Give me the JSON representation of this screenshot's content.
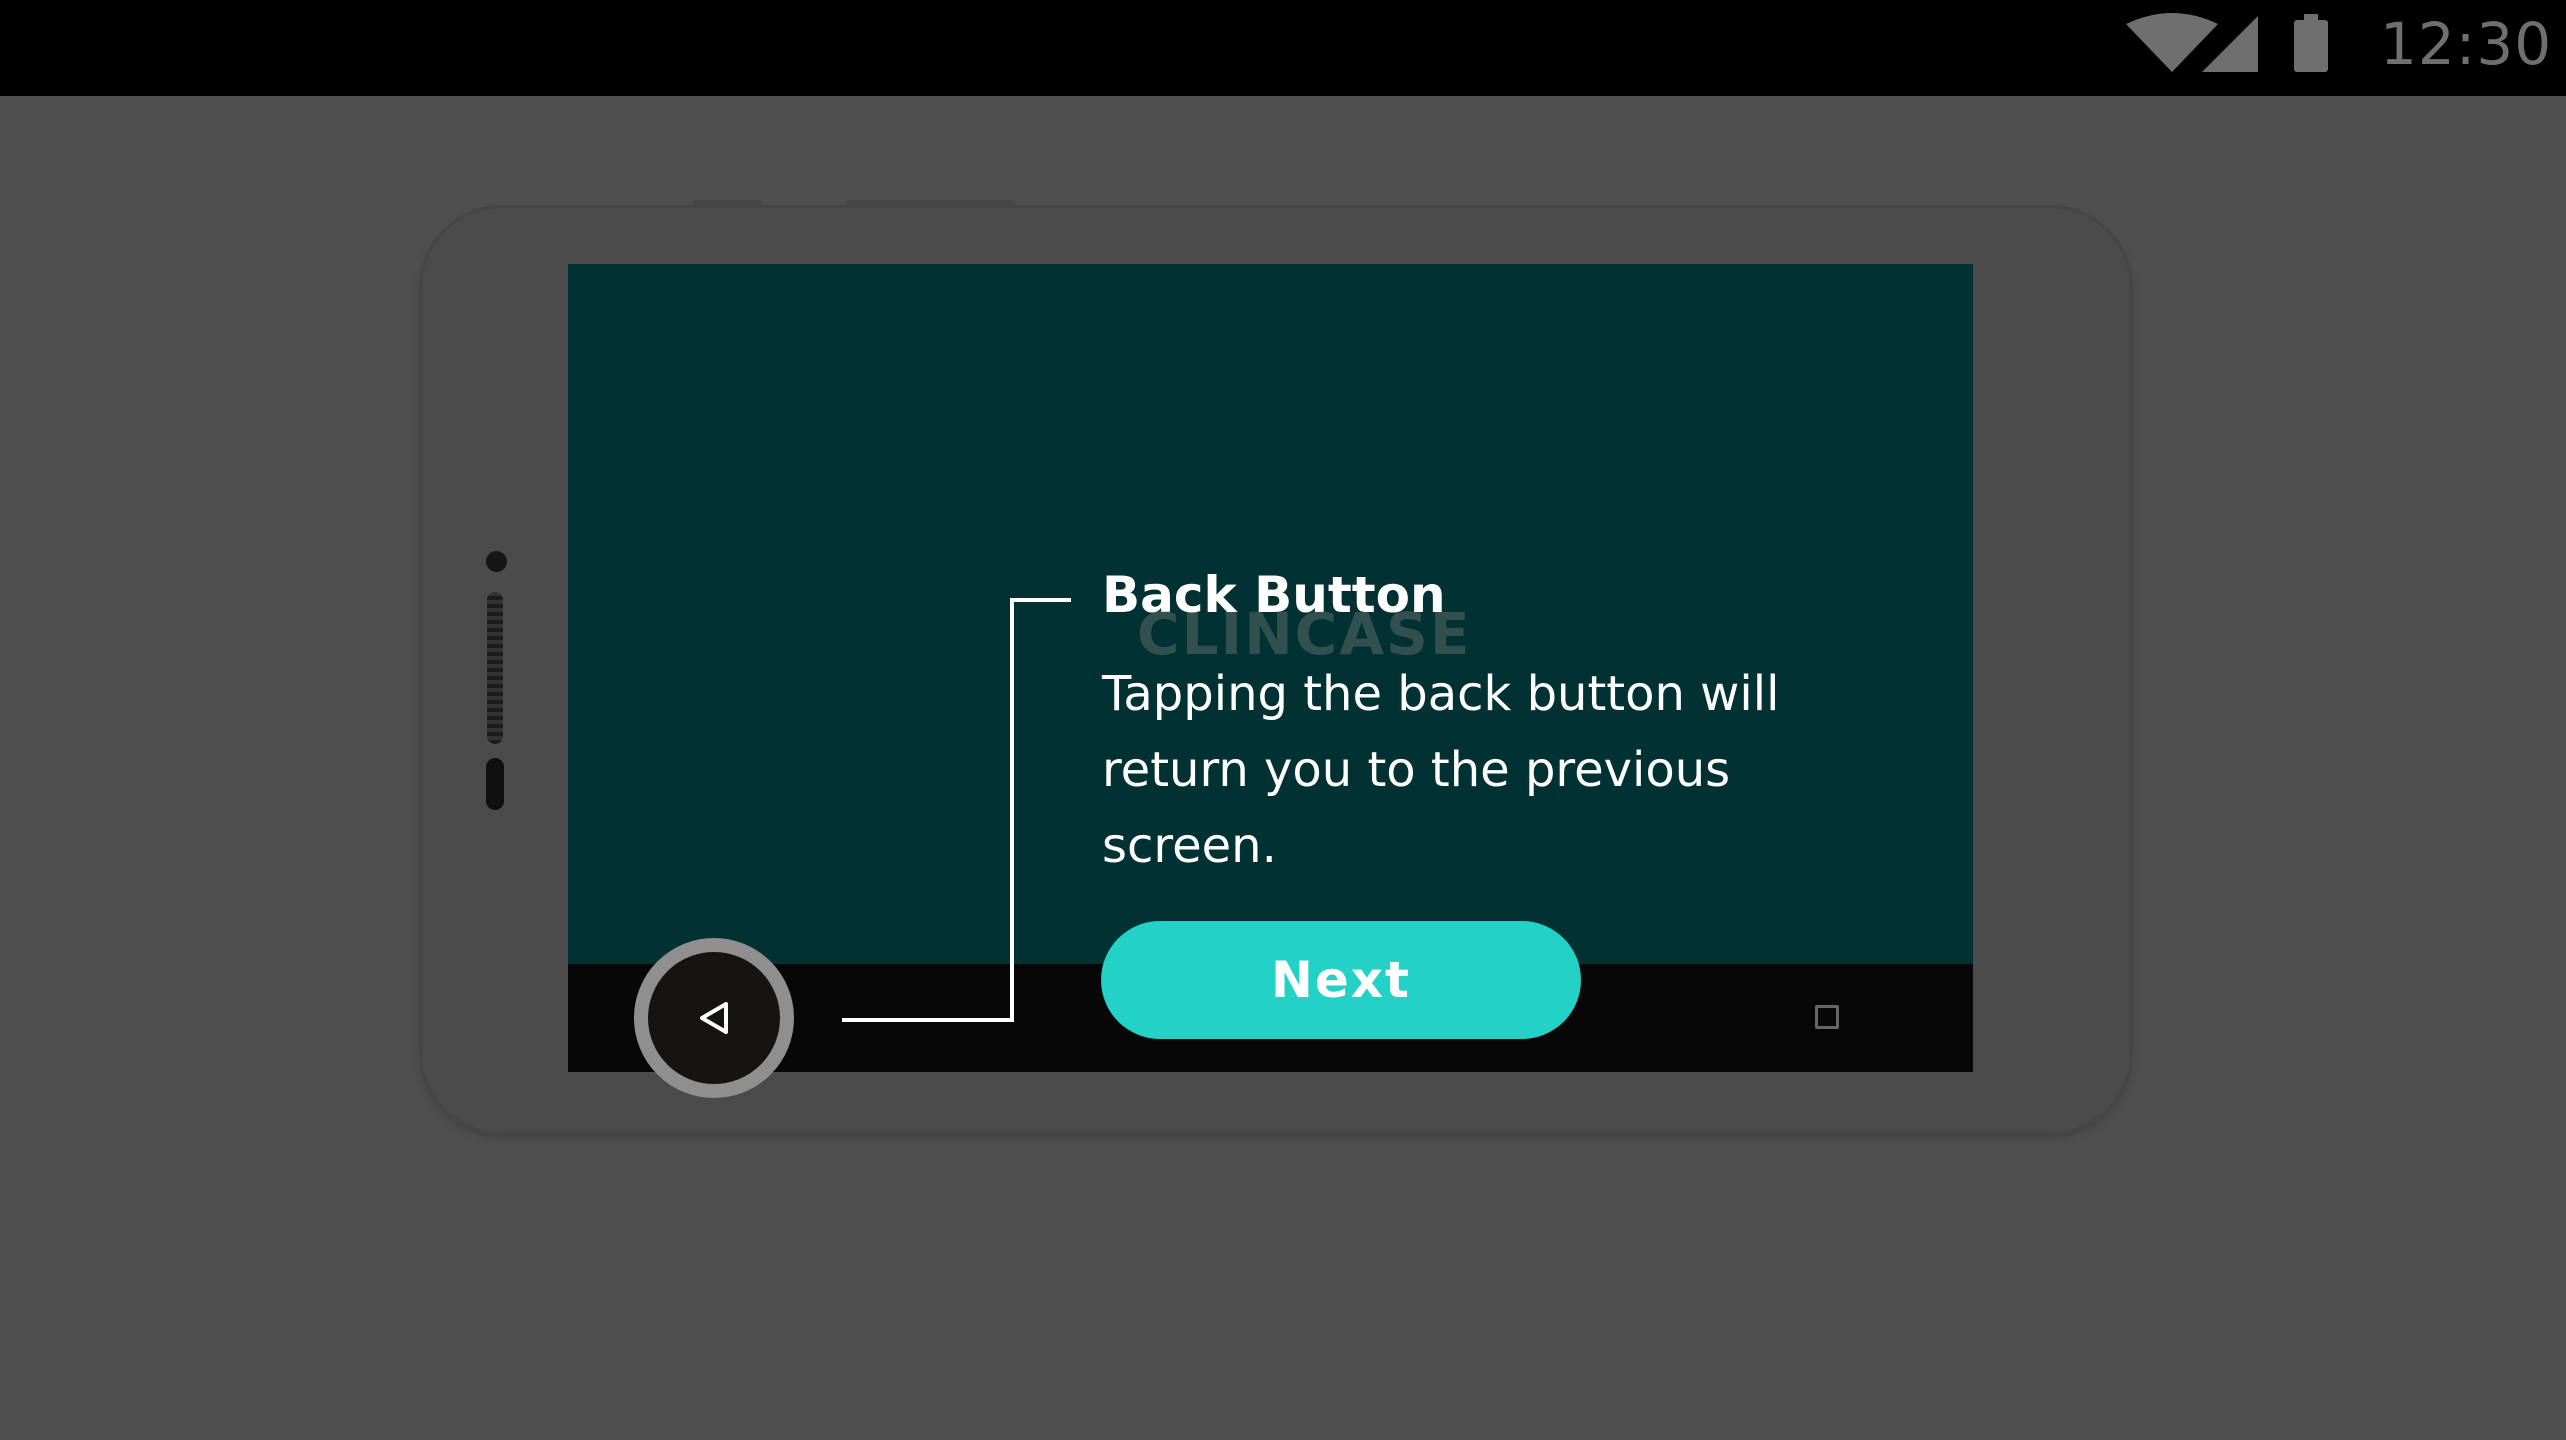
{
  "status_bar": {
    "time": "12:30",
    "icons": [
      "wifi-icon",
      "cellular-signal-icon",
      "battery-icon"
    ]
  },
  "background_app": {
    "brand_text": "CLINCASE",
    "screen_color": "#023134"
  },
  "tutorial": {
    "title": "Back Button",
    "body": "Tapping the back button will return you to the previous screen.",
    "next_label": "Next",
    "accent_color": "#23d1c6",
    "highlighted_control": "back-button-icon"
  },
  "nav_bar": {
    "icons": [
      "back-icon",
      "recents-icon"
    ]
  }
}
